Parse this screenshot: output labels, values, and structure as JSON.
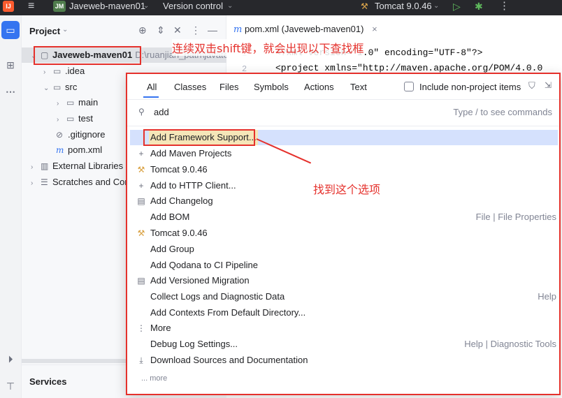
{
  "titlebar": {
    "logo_text": "IJ",
    "project_badge": "JM",
    "project_name": "Javeweb-maven01",
    "vcs": "Version control",
    "run_config": "Tomcat 9.0.46"
  },
  "project_panel": {
    "title": "Project",
    "tree": [
      {
        "label": "Javeweb-maven01",
        "path": "D:\\ruanjian_path\\javates",
        "arrow": "⌄",
        "icon": "module-folder-icon"
      },
      {
        "label": ".idea",
        "arrow": "›",
        "icon": "folder-icon"
      },
      {
        "label": "src",
        "arrow": "⌄",
        "icon": "folder-icon"
      },
      {
        "label": "main",
        "arrow": "›",
        "icon": "folder-icon"
      },
      {
        "label": "test",
        "arrow": "›",
        "icon": "folder-icon"
      },
      {
        "label": ".gitignore",
        "arrow": "",
        "icon": "ignore-file-icon"
      },
      {
        "label": "pom.xml",
        "arrow": "",
        "icon": "maven-file-icon"
      },
      {
        "label": "External Libraries",
        "arrow": "›",
        "icon": "library-icon"
      },
      {
        "label": "Scratches and Cor",
        "arrow": "›",
        "icon": "scratches-icon"
      }
    ],
    "services_label": "Services"
  },
  "editor": {
    "tab_prefix": "m",
    "tab_label": "pom.xml (Javeweb-maven01)",
    "tab_close": "×",
    "lines": [
      {
        "num": "1",
        "text": "<?xml version=\"1.0\" encoding=\"UTF-8\"?>"
      },
      {
        "num": "2",
        "text": "<project xmlns=\"http://maven.apache.org/POM/4.0.0"
      }
    ]
  },
  "annotations": {
    "top_note": "连续双击shift键，就会出现以下查找框",
    "option_note": "找到这个选项"
  },
  "search_popup": {
    "tabs": [
      "All",
      "Classes",
      "Files",
      "Symbols",
      "Actions",
      "Text"
    ],
    "include_non_project": "Include non-project items",
    "query": "add",
    "hint": "Type / to see commands",
    "results": [
      {
        "label": "Add Framework Support...",
        "hint": "",
        "icon": "none",
        "selected": true
      },
      {
        "label": "Add Maven Projects",
        "hint": "",
        "icon": "plus-icon"
      },
      {
        "label": "Tomcat 9.0.46",
        "hint": "",
        "icon": "tomcat-icon"
      },
      {
        "label": "Add to HTTP Client...",
        "hint": "",
        "icon": "plus-icon"
      },
      {
        "label": "Add Changelog",
        "hint": "",
        "icon": "changelog-icon"
      },
      {
        "label": "Add BOM",
        "hint": "File | File Properties",
        "icon": "none"
      },
      {
        "label": "Tomcat 9.0.46",
        "hint": "",
        "icon": "tomcat-icon"
      },
      {
        "label": "Add Group",
        "hint": "",
        "icon": "none"
      },
      {
        "label": "Add Qodana to CI Pipeline",
        "hint": "",
        "icon": "none"
      },
      {
        "label": "Add Versioned Migration",
        "hint": "",
        "icon": "changelog-icon"
      },
      {
        "label": "Collect Logs and Diagnostic Data",
        "hint": "Help",
        "icon": "none"
      },
      {
        "label": "Add Contexts From Default Directory...",
        "hint": "",
        "icon": "none"
      },
      {
        "label": "More",
        "hint": "",
        "icon": "more-icon"
      },
      {
        "label": "Debug Log Settings...",
        "hint": "Help | Diagnostic Tools",
        "icon": "none"
      },
      {
        "label": "Download Sources and Documentation",
        "hint": "",
        "icon": "download-icon"
      }
    ],
    "more_link": "... more"
  },
  "colors": {
    "accent": "#3574f0",
    "annotation_red": "#e5312c",
    "selection": "#d5e1fd"
  }
}
